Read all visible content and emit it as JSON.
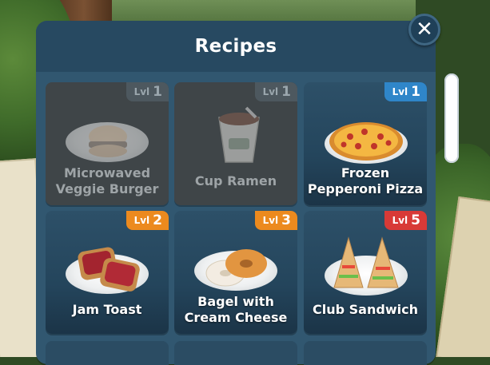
{
  "window": {
    "title": "Recipes"
  },
  "close_label": "✕",
  "level_prefix": "Lvl",
  "colors": {
    "panel": "#315770",
    "header": "#274961",
    "lvl_blue": "#2f86c9",
    "lvl_orange": "#ec8a1e",
    "lvl_red": "#d83a37",
    "locked": "#4d585f"
  },
  "recipes": [
    {
      "name_l1": "Microwaved",
      "name_l2": "Veggie Burger",
      "level": "1",
      "locked": true,
      "icon": "veggie-burger-icon"
    },
    {
      "name_l1": "Cup Ramen",
      "name_l2": "",
      "level": "1",
      "locked": true,
      "icon": "cup-ramen-icon"
    },
    {
      "name_l1": "Frozen",
      "name_l2": "Pepperoni Pizza",
      "level": "1",
      "locked": false,
      "icon": "pizza-icon",
      "badge_color": "lvl_blue"
    },
    {
      "name_l1": "Jam Toast",
      "name_l2": "",
      "level": "2",
      "locked": false,
      "icon": "jam-toast-icon",
      "badge_color": "lvl_orange"
    },
    {
      "name_l1": "Bagel with",
      "name_l2": "Cream Cheese",
      "level": "3",
      "locked": false,
      "icon": "bagel-icon",
      "badge_color": "lvl_orange"
    },
    {
      "name_l1": "Club Sandwich",
      "name_l2": "",
      "level": "5",
      "locked": false,
      "icon": "sandwich-icon",
      "badge_color": "lvl_red"
    }
  ]
}
